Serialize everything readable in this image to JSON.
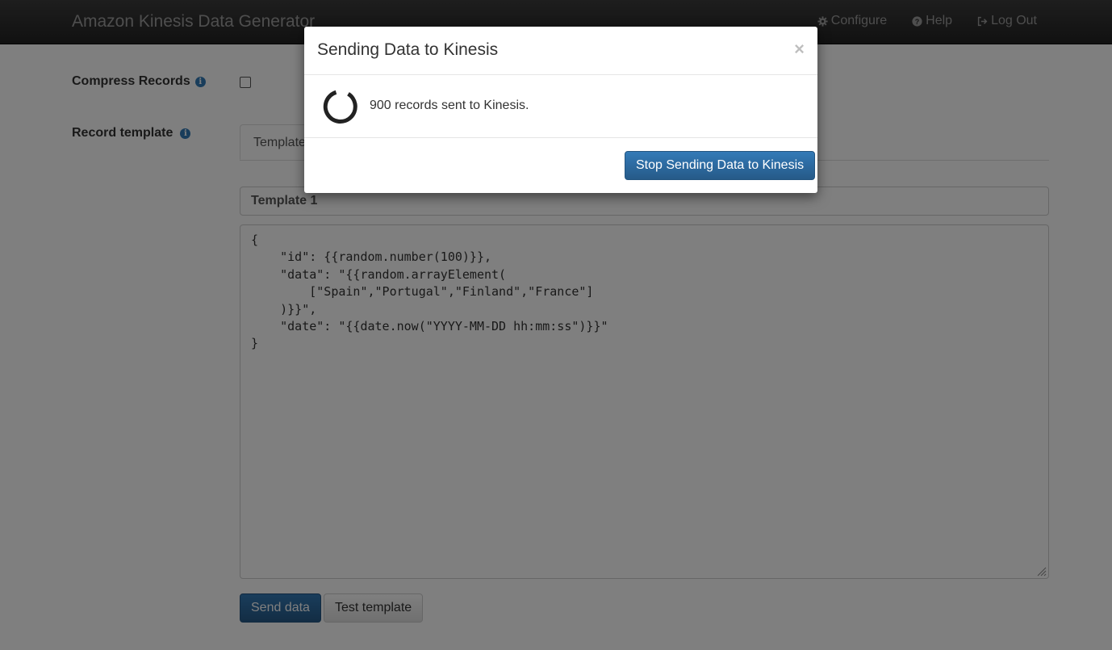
{
  "navbar": {
    "brand": "Amazon Kinesis Data Generator",
    "links": [
      {
        "label": "Configure",
        "icon": "gear-icon"
      },
      {
        "label": "Help",
        "icon": "question-circle-icon"
      },
      {
        "label": "Log Out",
        "icon": "logout-icon"
      }
    ]
  },
  "form": {
    "compress_label": "Compress Records",
    "compress_checked": false,
    "record_template_label": "Record template",
    "tab_label": "Template",
    "template_name": "Template 1",
    "template_body": "{\n    \"id\": {{random.number(100)}},\n    \"data\": \"{{random.arrayElement(\n        [\"Spain\",\"Portugal\",\"Finland\",\"France\"]\n    )}}\",\n    \"date\": \"{{date.now(\"YYYY-MM-DD hh:mm:ss\")}}\"\n}",
    "send_button": "Send data",
    "test_button": "Test template"
  },
  "modal": {
    "title": "Sending Data to Kinesis",
    "close_symbol": "×",
    "message": "900 records sent to Kinesis.",
    "stop_button": "Stop Sending Data to Kinesis"
  },
  "colors": {
    "navbar": "#222222",
    "primary": "#337ab7",
    "backdrop": "rgba(0,0,0,0.5)"
  }
}
